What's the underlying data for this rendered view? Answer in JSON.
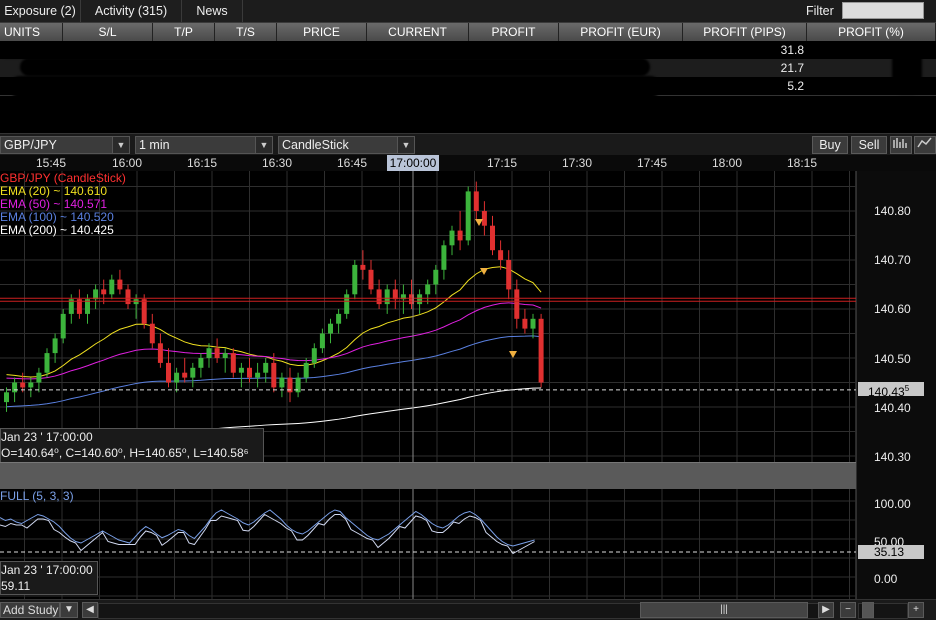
{
  "tabs": [
    {
      "label": "Exposure (2)"
    },
    {
      "label": "Activity (315)"
    },
    {
      "label": "News"
    }
  ],
  "filter": {
    "label": "Filter",
    "value": ""
  },
  "positions": {
    "columns": [
      "UNITS",
      "S/L",
      "T/P",
      "T/S",
      "PRICE",
      "CURRENT",
      "PROFIT",
      "PROFIT (EUR)",
      "PROFIT (PIPS)",
      "PROFIT (%)"
    ],
    "rows": [
      {
        "profit_pips": "31.8"
      },
      {
        "profit_pips": "21.7"
      },
      {
        "profit_pips": "5.2"
      }
    ]
  },
  "toolbar": {
    "instrument": "GBP/JPY",
    "interval": "1 min",
    "chart_type": "CandleStick",
    "buy_label": "Buy",
    "sell_label": "Sell"
  },
  "time_axis": {
    "labels": [
      "15:45",
      "16:00",
      "16:15",
      "16:30",
      "16:45",
      "17:15",
      "17:30",
      "17:45",
      "18:00",
      "18:15"
    ],
    "cursor": "17:00:00"
  },
  "legend": [
    {
      "text": "GBP/JPY (CandleStick)",
      "color": "#ff3030"
    },
    {
      "text": "EMA (20) ~ 140.610",
      "color": "#f0e020"
    },
    {
      "text": "EMA (50) ~ 140.571",
      "color": "#e020e0"
    },
    {
      "text": "EMA (100) ~ 140.520",
      "color": "#5a80e0"
    },
    {
      "text": "EMA (200) ~ 140.425",
      "color": "#ffffff"
    }
  ],
  "price_axis": {
    "labels": [
      "140.80",
      "140.70",
      "140.60",
      "140.50",
      "140.40",
      "140.30"
    ],
    "current_price": "140.43",
    "current_price_sup": "5"
  },
  "ohlc": {
    "date": "Jan 23 ' 17:00:00",
    "values": "O=140.64⁰, C=140.60⁰, H=140.65⁰, L=140.58⁶"
  },
  "stochastic": {
    "title": "FULL (5, 3, 3)",
    "axis_labels": [
      "100.00",
      "50.00",
      "0.00"
    ],
    "current": "35.13",
    "date": "Jan 23 ' 17:00:00",
    "value": "59.11"
  },
  "bottom": {
    "add_study_label": "Add Study"
  },
  "colors": {
    "candle_up": "#3cb43c",
    "candle_down": "#e03030",
    "resistance_line": "#cc2020",
    "grid": "#2e2e2e"
  },
  "chart_data": {
    "type": "candlestick",
    "instrument": "GBP/JPY",
    "interval": "1 min",
    "x_range": [
      "15:40",
      "18:25"
    ],
    "y_range": [
      140.25,
      140.88
    ],
    "ohlc": [
      [
        140.41,
        140.44,
        140.39,
        140.43
      ],
      [
        140.43,
        140.46,
        140.41,
        140.45
      ],
      [
        140.45,
        140.47,
        140.43,
        140.44
      ],
      [
        140.44,
        140.46,
        140.42,
        140.45
      ],
      [
        140.45,
        140.48,
        140.43,
        140.47
      ],
      [
        140.47,
        140.52,
        140.46,
        140.51
      ],
      [
        140.51,
        140.55,
        140.49,
        140.54
      ],
      [
        140.54,
        140.6,
        140.53,
        140.59
      ],
      [
        140.59,
        140.63,
        140.57,
        140.62
      ],
      [
        140.62,
        140.64,
        140.58,
        140.59
      ],
      [
        140.59,
        140.63,
        140.57,
        140.62
      ],
      [
        140.62,
        140.65,
        140.6,
        140.64
      ],
      [
        140.64,
        140.66,
        140.61,
        140.63
      ],
      [
        140.63,
        140.67,
        140.62,
        140.66
      ],
      [
        140.66,
        140.68,
        140.63,
        140.64
      ],
      [
        140.64,
        140.65,
        140.6,
        140.61
      ],
      [
        140.61,
        140.63,
        140.58,
        140.62
      ],
      [
        140.62,
        140.63,
        140.56,
        140.57
      ],
      [
        140.57,
        140.59,
        140.52,
        140.53
      ],
      [
        140.53,
        140.55,
        140.48,
        140.49
      ],
      [
        140.49,
        140.52,
        140.44,
        140.45
      ],
      [
        140.45,
        140.48,
        140.43,
        140.47
      ],
      [
        140.47,
        140.5,
        140.45,
        140.46
      ],
      [
        140.46,
        140.49,
        140.44,
        140.48
      ],
      [
        140.48,
        140.51,
        140.46,
        140.5
      ],
      [
        140.5,
        140.53,
        140.48,
        140.52
      ],
      [
        140.52,
        140.54,
        140.49,
        140.5
      ],
      [
        140.5,
        140.52,
        140.47,
        140.51
      ],
      [
        140.51,
        140.52,
        140.46,
        140.47
      ],
      [
        140.47,
        140.49,
        140.44,
        140.48
      ],
      [
        140.48,
        140.5,
        140.45,
        140.46
      ],
      [
        140.46,
        140.49,
        140.44,
        140.47
      ],
      [
        140.47,
        140.5,
        140.45,
        140.49
      ],
      [
        140.49,
        140.51,
        140.43,
        140.44
      ],
      [
        140.44,
        140.47,
        140.42,
        140.46
      ],
      [
        140.46,
        140.48,
        140.41,
        140.43
      ],
      [
        140.43,
        140.47,
        140.42,
        140.46
      ],
      [
        140.46,
        140.5,
        140.45,
        140.49
      ],
      [
        140.49,
        140.53,
        140.48,
        140.52
      ],
      [
        140.52,
        140.56,
        140.51,
        140.55
      ],
      [
        140.55,
        140.58,
        140.53,
        140.57
      ],
      [
        140.57,
        140.6,
        140.55,
        140.59
      ],
      [
        140.59,
        140.64,
        140.58,
        140.63
      ],
      [
        140.63,
        140.7,
        140.62,
        140.69
      ],
      [
        140.69,
        140.72,
        140.66,
        140.68
      ],
      [
        140.68,
        140.7,
        140.63,
        140.64
      ],
      [
        140.64,
        140.66,
        140.6,
        140.61
      ],
      [
        140.61,
        140.65,
        140.59,
        140.64
      ],
      [
        140.64,
        140.66,
        140.6,
        140.62
      ],
      [
        140.62,
        140.65,
        140.59,
        140.63
      ],
      [
        140.63,
        140.66,
        140.6,
        140.61
      ],
      [
        140.61,
        140.64,
        140.59,
        140.63
      ],
      [
        140.63,
        140.66,
        140.61,
        140.65
      ],
      [
        140.65,
        140.69,
        140.63,
        140.68
      ],
      [
        140.68,
        140.74,
        140.66,
        140.73
      ],
      [
        140.73,
        140.77,
        140.71,
        140.76
      ],
      [
        140.76,
        140.8,
        140.72,
        140.74
      ],
      [
        140.74,
        140.85,
        140.73,
        140.84
      ],
      [
        140.84,
        140.86,
        140.78,
        140.8
      ],
      [
        140.8,
        140.82,
        140.75,
        140.77
      ],
      [
        140.77,
        140.79,
        140.71,
        140.72
      ],
      [
        140.72,
        140.74,
        140.68,
        140.7
      ],
      [
        140.7,
        140.72,
        140.62,
        140.64
      ],
      [
        140.64,
        140.66,
        140.56,
        140.58
      ],
      [
        140.58,
        140.6,
        140.55,
        140.56
      ],
      [
        140.56,
        140.59,
        140.54,
        140.58
      ],
      [
        140.58,
        140.59,
        140.44,
        140.45
      ]
    ],
    "ema": [
      {
        "name": "EMA (20)",
        "value": 140.61
      },
      {
        "name": "EMA (50)",
        "value": 140.571
      },
      {
        "name": "EMA (100)",
        "value": 140.52
      },
      {
        "name": "EMA (200)",
        "value": 140.425
      }
    ],
    "horizontal_line": 140.62,
    "current_price": 140.435
  }
}
